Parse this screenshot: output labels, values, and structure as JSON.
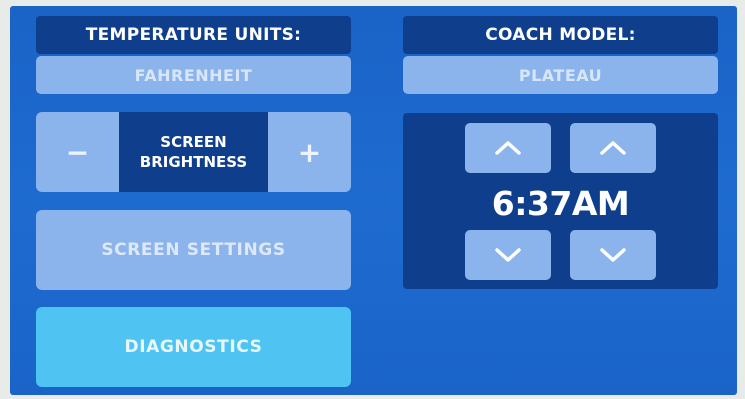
{
  "temperature": {
    "label": "TEMPERATURE UNITS:",
    "value": "FAHRENHEIT"
  },
  "coach": {
    "label": "COACH MODEL:",
    "value": "PLATEAU"
  },
  "brightness": {
    "minus": "−",
    "label_line1": "SCREEN",
    "label_line2": "BRIGHTNESS",
    "plus": "+"
  },
  "buttons": {
    "screen_settings": "SCREEN SETTINGS",
    "diagnostics": "DIAGNOSTICS"
  },
  "clock": {
    "time": "6:37AM",
    "hour_up_icon": "chevron-up-icon",
    "minute_up_icon": "chevron-up-icon",
    "hour_down_icon": "chevron-down-icon",
    "minute_down_icon": "chevron-down-icon"
  },
  "colors": {
    "screen_blue": "#1e6bd0",
    "label_navy": "#0f3e8c",
    "button_light": "#8cb4ec",
    "diagnostics_cyan": "#4fc3f2"
  }
}
